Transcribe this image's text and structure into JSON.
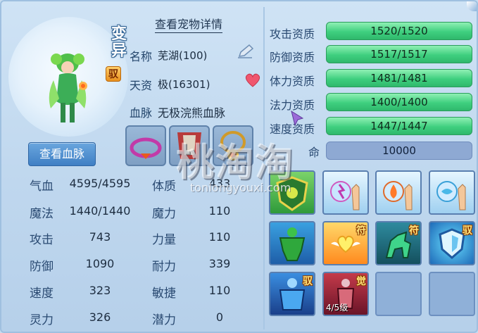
{
  "pet": {
    "transform_badge": "变异",
    "bind_tag": "驭",
    "view_details_link": "查看宠物详情",
    "name_label": "名称",
    "name_value": "芜湖(100)",
    "aptitude_label": "天资",
    "aptitude_value": "极(16301)",
    "bloodline_label": "血脉",
    "bloodline_value": "无极浣熊血脉",
    "view_bloodline_button": "查看血脉"
  },
  "stats": {
    "left": [
      {
        "label": "气血",
        "value": "4595/4595"
      },
      {
        "label": "魔法",
        "value": "1440/1440"
      },
      {
        "label": "攻击",
        "value": "743"
      },
      {
        "label": "防御",
        "value": "1090"
      },
      {
        "label": "速度",
        "value": "323"
      },
      {
        "label": "灵力",
        "value": "326"
      }
    ],
    "right": [
      {
        "label": "体质",
        "value": "433"
      },
      {
        "label": "魔力",
        "value": "110"
      },
      {
        "label": "力量",
        "value": "110"
      },
      {
        "label": "耐力",
        "value": "339"
      },
      {
        "label": "敏捷",
        "value": "110"
      },
      {
        "label": "潜力",
        "value": "0"
      }
    ]
  },
  "aptitudes": [
    {
      "label": "攻击资质",
      "value": "1520/1520"
    },
    {
      "label": "防御资质",
      "value": "1517/1517"
    },
    {
      "label": "体力资质",
      "value": "1481/1481"
    },
    {
      "label": "法力资质",
      "value": "1400/1400"
    },
    {
      "label": "速度资质",
      "value": "1447/1447"
    }
  ],
  "lifespan": {
    "label": "命",
    "value": "10000"
  },
  "skills": [
    {
      "icon": "shield-cursed-skill-icon",
      "tag": ""
    },
    {
      "icon": "hand-lightning-skill-icon",
      "tag": ""
    },
    {
      "icon": "hand-fire-skill-icon",
      "tag": ""
    },
    {
      "icon": "hand-water-skill-icon",
      "tag": ""
    },
    {
      "icon": "green-strongman-skill-icon",
      "tag": ""
    },
    {
      "icon": "winged-heart-skill-icon",
      "tag": "符"
    },
    {
      "icon": "green-horse-skill-icon",
      "tag": "符"
    },
    {
      "icon": "blue-shield-skill-icon",
      "tag": "驭"
    },
    {
      "icon": "blue-guardian-skill-icon",
      "tag": "驭"
    },
    {
      "icon": "red-warrior-skill-icon",
      "tag": "觉",
      "level": "4/5级"
    }
  ],
  "watermark": {
    "main": "桃淘淘",
    "sub": "tonlongyouxi.com"
  },
  "colors": {
    "bar_green": "#3fcf7f",
    "button_blue": "#3f7fc4",
    "panel_bg": "#c7ddf0"
  }
}
